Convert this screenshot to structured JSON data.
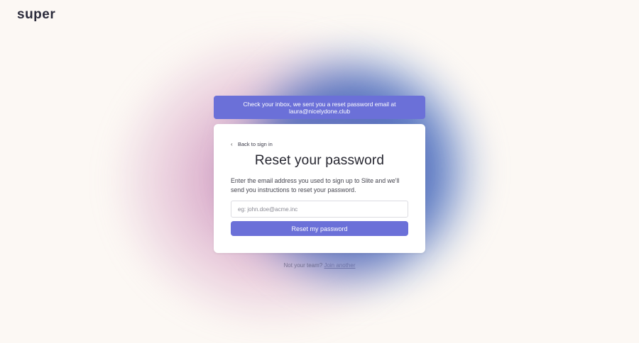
{
  "brand": {
    "logo_text": "super"
  },
  "banner": {
    "line1": "Check your inbox, we sent you a reset password email at",
    "line2": "laura@nicelydone.club"
  },
  "card": {
    "back_label": "Back to sign in",
    "title": "Reset your password",
    "description": "Enter the email address you used to sign up to Slite and we'll send you instructions to reset your password.",
    "email_placeholder": "eg: john.doe@acme.inc",
    "email_value": "",
    "submit_label": "Reset my password"
  },
  "footer": {
    "prompt": "Not your team?",
    "link_label": "Join another"
  },
  "colors": {
    "accent": "#6b70d8",
    "background": "#fcf8f4",
    "title": "#25252f"
  },
  "icons": {
    "back": "chevron-left-icon"
  }
}
